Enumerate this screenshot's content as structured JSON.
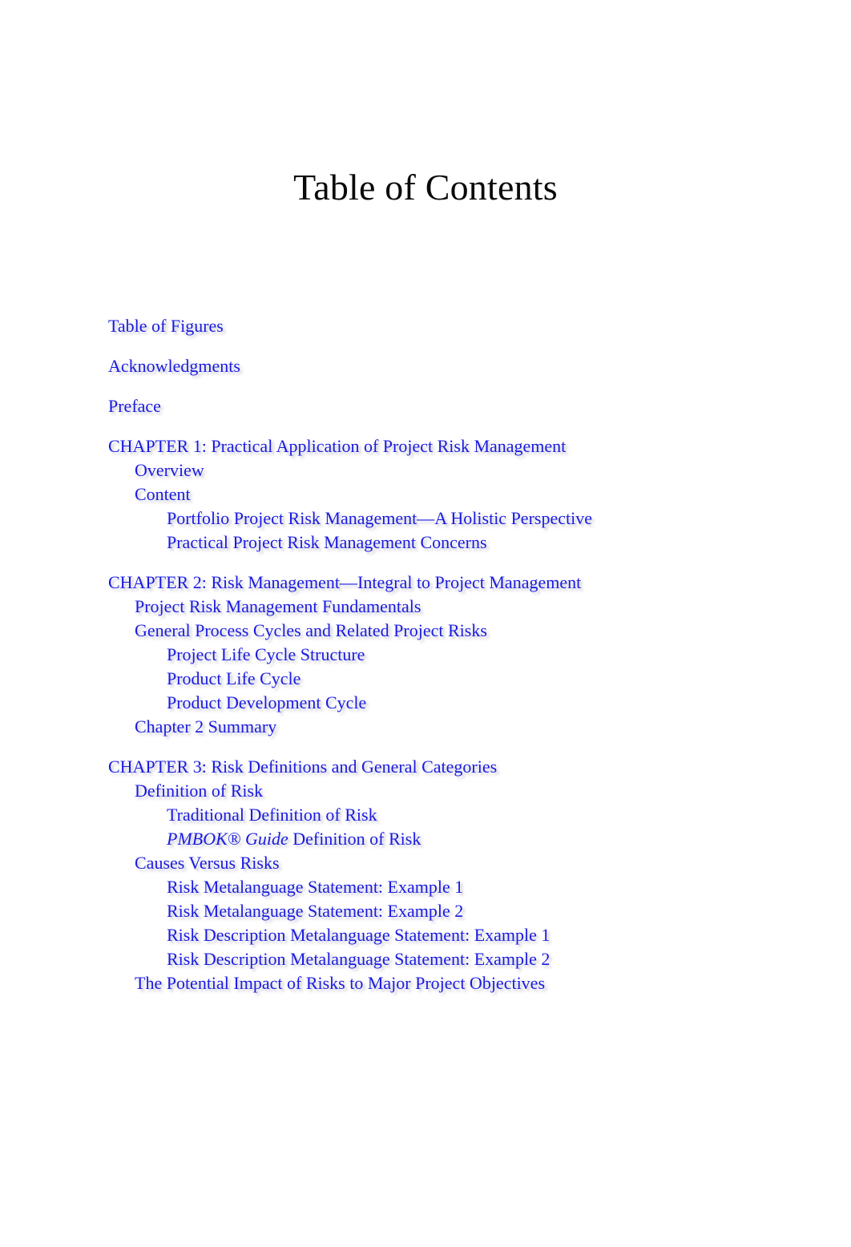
{
  "page": {
    "title": "Table of Contents",
    "background_color": "#ffffff",
    "link_color": "#1a1ae0",
    "title_color": "#0a0a0a"
  },
  "front_matter": [
    {
      "label": "Table of Figures",
      "level": 0
    },
    {
      "label": "Acknowledgments",
      "level": 0
    },
    {
      "label": "Preface",
      "level": 0
    }
  ],
  "chapters": [
    {
      "heading": "CHAPTER 1: Practical Application of Project Risk Management",
      "heading_level": 0,
      "entries": [
        {
          "label": "Overview",
          "level": 1
        },
        {
          "label": "Content",
          "level": 1
        },
        {
          "label": "Portfolio Project Risk Management—A Holistic Perspective",
          "level": 2
        },
        {
          "label": "Practical Project Risk Management Concerns",
          "level": 2
        }
      ]
    },
    {
      "heading": "CHAPTER 2: Risk Management—Integral to Project Management",
      "heading_level": 0,
      "entries": [
        {
          "label": "Project Risk Management Fundamentals",
          "level": 1
        },
        {
          "label": "General Process Cycles and Related Project Risks",
          "level": 1
        },
        {
          "label": "Project Life Cycle Structure",
          "level": 2
        },
        {
          "label": "Product Life Cycle",
          "level": 2
        },
        {
          "label": "Product Development Cycle",
          "level": 2
        },
        {
          "label": "Chapter 2 Summary",
          "level": 1
        }
      ]
    },
    {
      "heading": "CHAPTER 3: Risk Definitions and General Categories",
      "heading_level": 0,
      "entries": [
        {
          "label": "Definition of Risk",
          "level": 1
        },
        {
          "label": "Traditional Definition of Risk",
          "level": 2
        },
        {
          "label": "PMBOK® Guide Definition of Risk",
          "level": 2,
          "italic_prefix": "PMBOK® Guide",
          "plain_suffix": " Definition of Risk"
        },
        {
          "label": "Causes Versus Risks",
          "level": 1
        },
        {
          "label": "Risk Metalanguage Statement: Example 1",
          "level": 2
        },
        {
          "label": "Risk Metalanguage Statement: Example 2",
          "level": 2
        },
        {
          "label": "Risk Description Metalanguage Statement: Example 1",
          "level": 2
        },
        {
          "label": "Risk Description Metalanguage Statement: Example 2",
          "level": 2
        },
        {
          "label": "The Potential Impact of Risks to Major Project Objectives",
          "level": 1
        }
      ]
    }
  ]
}
